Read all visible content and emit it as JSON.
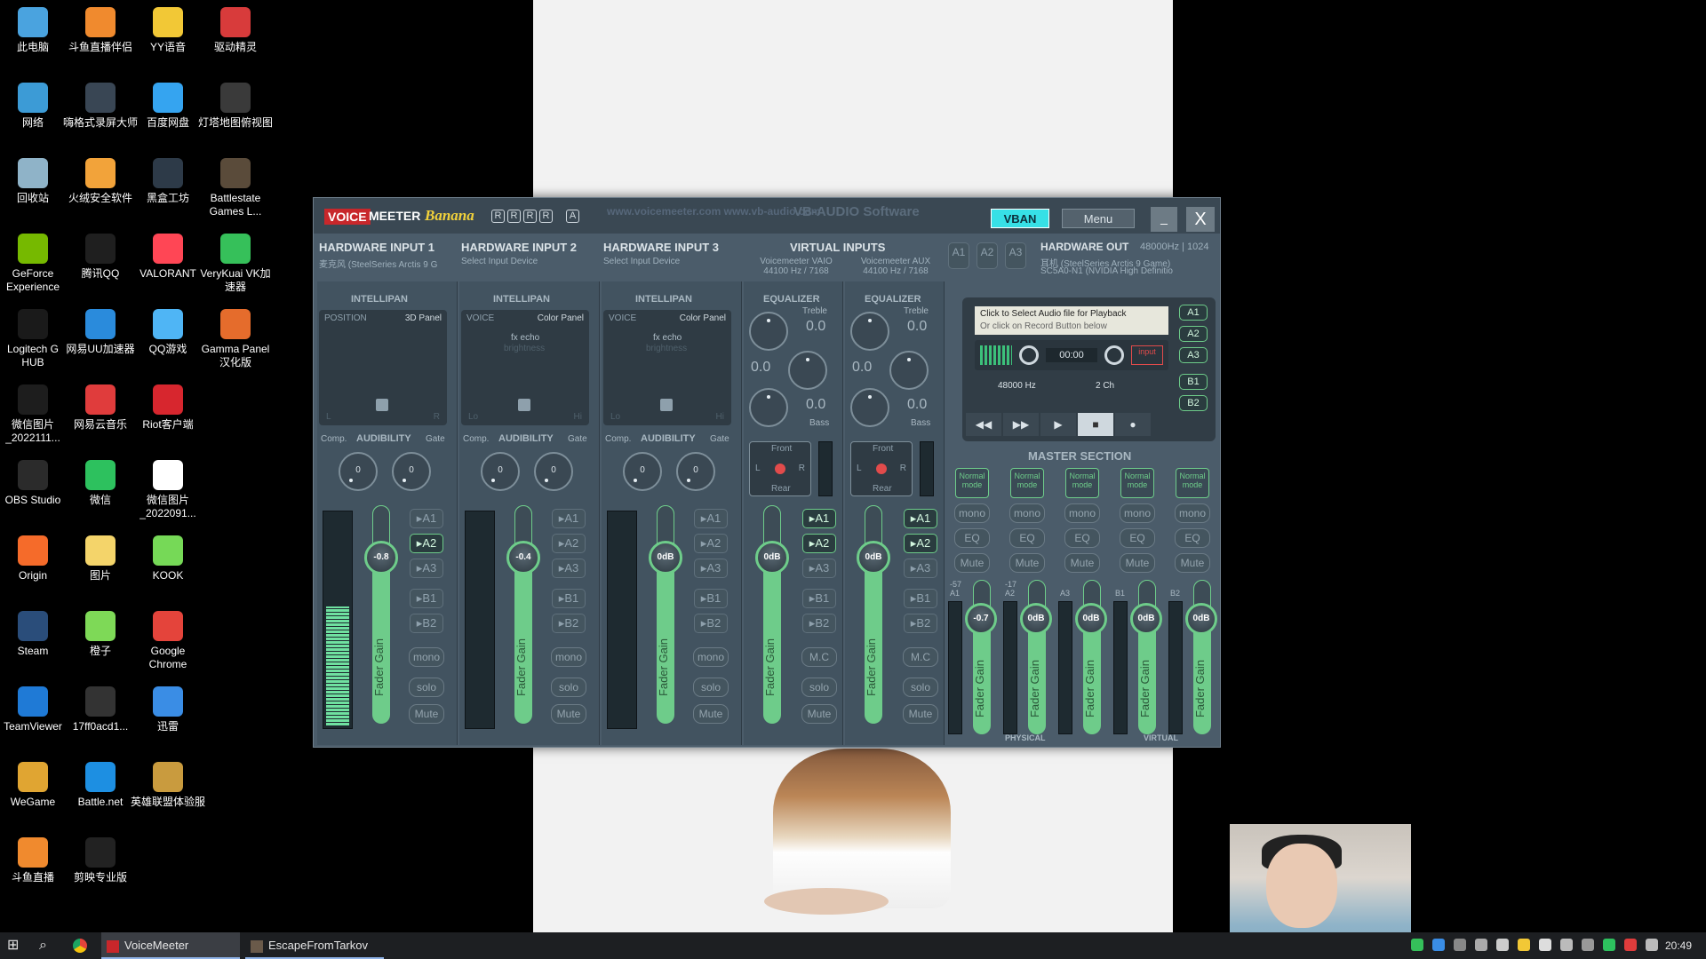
{
  "desktop": {
    "icons": [
      {
        "label": "此电脑",
        "color": "#4aa3df"
      },
      {
        "label": "斗鱼直播伴侣",
        "color": "#f08a2e"
      },
      {
        "label": "YY语音",
        "color": "#f2c836"
      },
      {
        "label": "网络",
        "color": "#3c9bd6"
      },
      {
        "label": "嗨格式录屏大师",
        "color": "#394654"
      },
      {
        "label": "百度网盘",
        "color": "#35a4f0"
      },
      {
        "label": "驱动精灵",
        "color": "#d83b3b"
      },
      {
        "label": "回收站",
        "color": "#8fb3c8"
      },
      {
        "label": "火绒安全软件",
        "color": "#f2a33a"
      },
      {
        "label": "黑盒工坊",
        "color": "#2d3a48"
      },
      {
        "label": "灯塔地图俯视图",
        "color": "#3a3a3a"
      },
      {
        "label": "GeForce Experience",
        "color": "#76b900"
      },
      {
        "label": "腾讯QQ",
        "color": "#1f1f1f"
      },
      {
        "label": "VALORANT",
        "color": "#ff4655"
      },
      {
        "label": "Battlestate Games L...",
        "color": "#5a4b3a"
      },
      {
        "label": "Logitech G HUB",
        "color": "#1a1a1a"
      },
      {
        "label": "网易UU加速器",
        "color": "#2a8bdc"
      },
      {
        "label": "QQ游戏",
        "color": "#4fb5f5"
      },
      {
        "label": "VeryKuai VK加速器",
        "color": "#36c05a"
      },
      {
        "label": "微信图片_2022111...",
        "color": "#1d1d1d"
      },
      {
        "label": "网易云音乐",
        "color": "#e03c3c"
      },
      {
        "label": "Riot客户端",
        "color": "#d7262e"
      },
      {
        "label": "Gamma Panel汉化版",
        "color": "#e56c2c"
      },
      {
        "label": "OBS Studio",
        "color": "#2b2b2b"
      },
      {
        "label": "微信",
        "color": "#2dc15e"
      },
      {
        "label": "微信图片_2022091...",
        "color": "#ffffff"
      },
      {
        "label": "Origin",
        "color": "#f56b2a"
      },
      {
        "label": "图片",
        "color": "#f4d46a"
      },
      {
        "label": "KOOK",
        "color": "#76d957"
      },
      {
        "label": "Steam",
        "color": "#2a4d7a"
      },
      {
        "label": "橙子",
        "color": "#7ed957"
      },
      {
        "label": "Google Chrome",
        "color": "#e4443b"
      },
      {
        "label": "TeamViewer",
        "color": "#1f7ad6"
      },
      {
        "label": "17ff0acd1...",
        "color": "#333333"
      },
      {
        "label": "迅雷",
        "color": "#3a8de5"
      },
      {
        "label": "WeGame",
        "color": "#e0a532"
      },
      {
        "label": "Battle.net",
        "color": "#1d8fe2"
      },
      {
        "label": "英雄联盟体验服",
        "color": "#c99b3e"
      },
      {
        "label": "斗鱼直播",
        "color": "#f08a2e"
      },
      {
        "label": "剪映专业版",
        "color": "#222222"
      }
    ]
  },
  "vm": {
    "brand_voice": "VOICE",
    "brand_meeter": "MEETER",
    "brand_banana": "Banana",
    "badges": [
      "R",
      "R",
      "R",
      "R",
      "A"
    ],
    "website": "www.voicemeeter.com  www.vb-audio.com",
    "vbaudio": "VB-AUDIO Software",
    "vban": "VBAN",
    "menu": "Menu",
    "minimize": "_",
    "close": "X",
    "hw1": {
      "title": "HARDWARE INPUT",
      "num": "1",
      "device": "麦克风 (SteelSeries Arctis 9 G"
    },
    "hw2": {
      "title": "HARDWARE INPUT",
      "num": "2",
      "device": "Select Input Device"
    },
    "hw3": {
      "title": "HARDWARE INPUT",
      "num": "3",
      "device": "Select Input Device"
    },
    "virtual_title": "VIRTUAL INPUTS",
    "vaio": {
      "name": "Voicemeeter VAIO",
      "rate": "44100 Hz / 7168"
    },
    "aux": {
      "name": "Voicemeeter AUX",
      "rate": "44100 Hz / 7168"
    },
    "hwout_title": "HARDWARE OUT",
    "hwout_rate": "48000Hz | 1024",
    "hwout_dev1": "耳机 (SteelSeries Arctis 9 Game)",
    "hwout_dev2": "SC5A0-N1 (NVIDIA High Definitio",
    "out_buttons": [
      "A1",
      "A2",
      "A3"
    ],
    "intellipan": "INTELLIPAN",
    "equalizer": "EQUALIZER",
    "position": "POSITION",
    "panel3d": "3D Panel",
    "voice": "VOICE",
    "color_panel": "Color Panel",
    "fx_echo": "fx echo",
    "brightness": "brightness",
    "lr_l": "L",
    "lr_r": "R",
    "lo": "Lo",
    "hi": "Hi",
    "comp": "Comp.",
    "audibility": "AUDIBILITY",
    "gate": "Gate",
    "knob_zero": "0",
    "treble": "Treble",
    "bass": "Bass",
    "eq_val": "0.0",
    "front": "Front",
    "rear": "Rear",
    "fader_gain": "Fader Gain",
    "strips": [
      {
        "gain": "-0.8",
        "level": 0.55,
        "buses": [
          "A1",
          "A2",
          "A3",
          "B1",
          "B2"
        ],
        "on": [
          false,
          true,
          false,
          false,
          false
        ],
        "b1": "mono",
        "b2": "solo",
        "b3": "Mute"
      },
      {
        "gain": "-0.4",
        "level": 0,
        "buses": [
          "A1",
          "A2",
          "A3",
          "B1",
          "B2"
        ],
        "on": [
          false,
          false,
          false,
          false,
          false
        ],
        "b1": "mono",
        "b2": "solo",
        "b3": "Mute"
      },
      {
        "gain": "0dB",
        "level": 0,
        "buses": [
          "A1",
          "A2",
          "A3",
          "B1",
          "B2"
        ],
        "on": [
          false,
          false,
          false,
          false,
          false
        ],
        "b1": "mono",
        "b2": "solo",
        "b3": "Mute"
      },
      {
        "gain": "0dB",
        "level": 0,
        "buses": [
          "A1",
          "A2",
          "A3",
          "B1",
          "B2"
        ],
        "on": [
          true,
          true,
          false,
          false,
          false
        ],
        "b1": "M.C",
        "b2": "solo",
        "b3": "Mute"
      },
      {
        "gain": "0dB",
        "level": 0,
        "buses": [
          "A1",
          "A2",
          "A3",
          "B1",
          "B2"
        ],
        "on": [
          true,
          true,
          false,
          false,
          false
        ],
        "b1": "M.C",
        "b2": "solo",
        "b3": "Mute"
      }
    ],
    "tape": {
      "line1": "Click to Select Audio file for Playback",
      "line2": "Or click on Record Button below",
      "time": "00:00",
      "input": "input",
      "hz": "48000 Hz",
      "ch": "2 Ch",
      "buses": [
        "A1",
        "A2",
        "A3",
        "B1",
        "B2"
      ],
      "ctl": [
        "◀◀",
        "▶▶",
        "▶",
        "■",
        "●"
      ]
    },
    "master_title": "MASTER SECTION",
    "master": [
      {
        "bus": "A1",
        "db": "-57",
        "gain": "-0.7"
      },
      {
        "bus": "A2",
        "db": "-17",
        "gain": "0dB"
      },
      {
        "bus": "A3",
        "db": "",
        "gain": "0dB"
      },
      {
        "bus": "B1",
        "db": "",
        "gain": "0dB"
      },
      {
        "bus": "B2",
        "db": "",
        "gain": "0dB"
      }
    ],
    "mode_label": "Normal mode",
    "m_mono": "mono",
    "m_eq": "EQ",
    "m_mute": "Mute",
    "physical": "PHYSICAL",
    "virtual": "VIRTUAL"
  },
  "taskbar": {
    "voicemeeter": "VoiceMeeter",
    "tarkov": "EscapeFromTarkov",
    "time": "20:49"
  }
}
